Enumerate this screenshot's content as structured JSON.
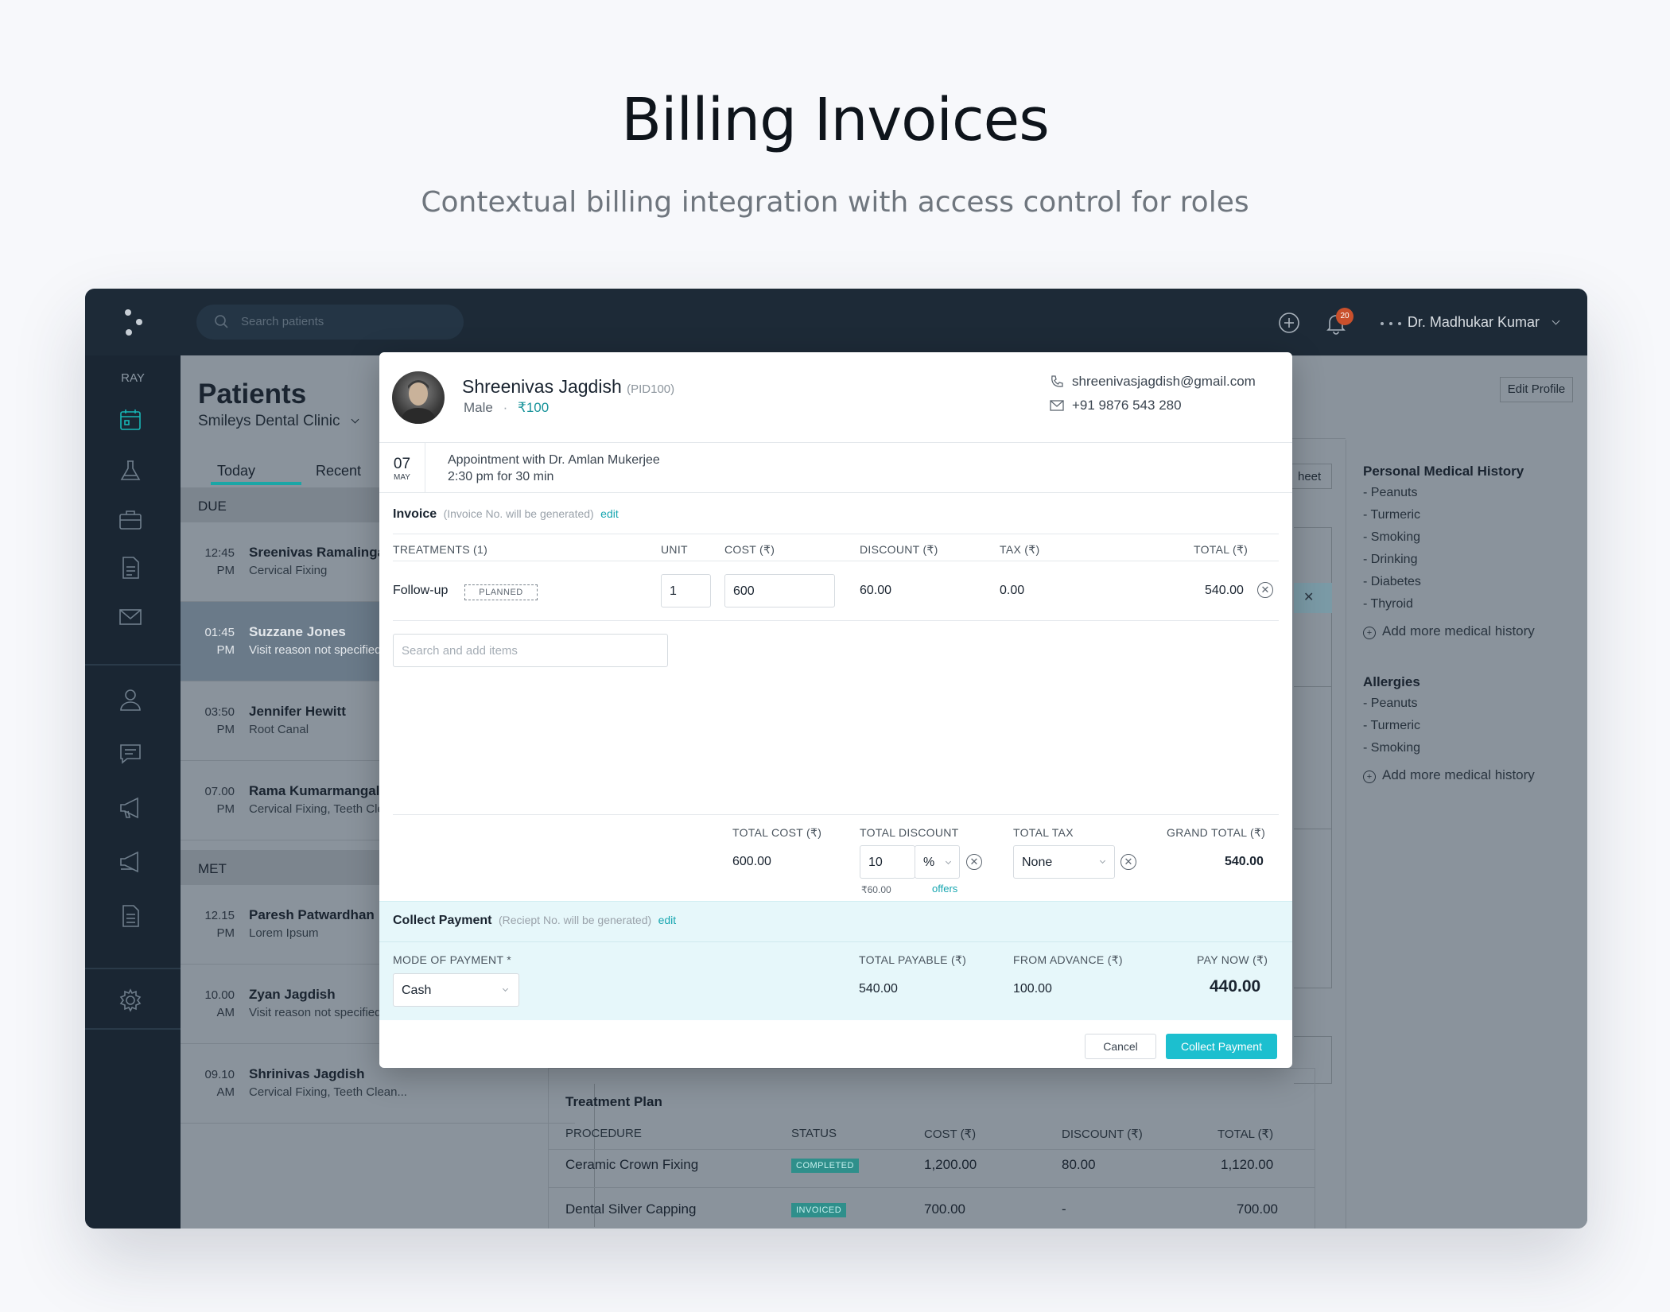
{
  "hero": {
    "title": "Billing Invoices",
    "subtitle": "Contextual billing integration with access control for roles"
  },
  "colors": {
    "accent": "#1cbfcf",
    "sidebar": "#1a2633",
    "badge": "#c9502c"
  },
  "topbar": {
    "search_placeholder": "Search patients",
    "notification_count": "20",
    "user_name": "Dr. Madhukar Kumar"
  },
  "sidebar": {
    "label": "RAY",
    "icons": [
      "calendar-icon",
      "flask-icon",
      "briefcase-icon",
      "document-icon",
      "mail-icon",
      "doctor-icon",
      "chat-icon",
      "megaphone-icon",
      "megaphone-alt-icon",
      "report-icon",
      "gear-icon"
    ]
  },
  "patients": {
    "title": "Patients",
    "clinic": "Smileys Dental Clinic",
    "tabs": [
      "Today",
      "Recent"
    ],
    "due_label": "DUE",
    "met_label": "MET",
    "due": [
      {
        "time": "12:45",
        "ampm": "PM",
        "name": "Sreenivas Ramalingam",
        "reason": "Cervical Fixing"
      },
      {
        "time": "01:45",
        "ampm": "PM",
        "name": "Suzzane Jones",
        "reason": "Visit reason not specified"
      },
      {
        "time": "03:50",
        "ampm": "PM",
        "name": "Jennifer Hewitt",
        "reason": "Root Canal"
      },
      {
        "time": "07.00",
        "ampm": "PM",
        "name": "Rama Kumarmangalam",
        "reason": "Cervical Fixing, Teeth Cleaning"
      }
    ],
    "met": [
      {
        "time": "12.15",
        "ampm": "PM",
        "name": "Paresh Patwardhan",
        "reason": "Lorem Ipsum"
      },
      {
        "time": "10.00",
        "ampm": "AM",
        "name": "Zyan Jagdish",
        "reason": "Visit reason not specified"
      },
      {
        "time": "09.10",
        "ampm": "AM",
        "name": "Shrinivas Jagdish",
        "reason": "Cervical Fixing, Teeth Clean..."
      }
    ]
  },
  "profile": {
    "edit_label": "Edit Profile",
    "sheet_label": "heet",
    "medical_history_title": "Personal Medical History",
    "medical_history": [
      "- Peanuts",
      "- Turmeric",
      "- Smoking",
      "- Drinking",
      "- Diabetes",
      "- Thyroid"
    ],
    "add_history": "Add more medical history",
    "allergies_title": "Allergies",
    "allergies": [
      "- Peanuts",
      "- Turmeric",
      "- Smoking"
    ],
    "add_allergies": "Add more medical history"
  },
  "treatment_plan": {
    "title": "Treatment Plan",
    "headers": [
      "PROCEDURE",
      "STATUS",
      "COST (₹)",
      "DISCOUNT (₹)",
      "TOTAL (₹)"
    ],
    "rows": [
      {
        "procedure": "Ceramic Crown Fixing",
        "status": "COMPLETED",
        "cost": "1,200.00",
        "discount": "80.00",
        "total": "1,120.00"
      },
      {
        "procedure": "Dental Silver Capping",
        "status": "INVOICED",
        "cost": "700.00",
        "discount": "-",
        "total": "700.00"
      }
    ]
  },
  "modal": {
    "patient_name": "Shreenivas Jagdish",
    "pid": "(PID100)",
    "gender": "Male",
    "fee": "₹100",
    "email": "shreenivasjagdish@gmail.com",
    "phone": "+91 9876 543 280",
    "appt_day": "07",
    "appt_month": "MAY",
    "appt_line1": "Appointment with Dr. Amlan Mukerjee",
    "appt_line2": "2:30 pm for 30 min",
    "invoice_title": "Invoice",
    "invoice_note": "(Invoice No. will be generated)",
    "edit": "edit",
    "headers": {
      "treatments": "TREATMENTS (1)",
      "unit": "UNIT",
      "cost": "COST (₹)",
      "discount": "DISCOUNT (₹)",
      "tax": "TAX (₹)",
      "total": "TOTAL (₹)"
    },
    "item": {
      "name": "Follow-up",
      "status": "PLANNED",
      "unit": "1",
      "cost": "600",
      "discount": "60.00",
      "tax": "0.00",
      "total": "540.00"
    },
    "search_placeholder": "Search and add items",
    "totals": {
      "cost_label": "TOTAL COST (₹)",
      "cost": "600.00",
      "discount_label": "TOTAL DISCOUNT",
      "discount_value": "10",
      "discount_unit": "%",
      "discount_amount": "₹60.00",
      "offers": "offers",
      "tax_label": "TOTAL TAX",
      "tax_value": "None",
      "grand_label": "GRAND  TOTAL (₹)",
      "grand": "540.00"
    },
    "payment": {
      "title": "Collect Payment",
      "note": "(Reciept No. will be generated)",
      "edit": "edit",
      "mode_label": "MODE OF PAYMENT *",
      "mode": "Cash",
      "payable_label": "TOTAL PAYABLE (₹)",
      "payable": "540.00",
      "advance_label": "FROM ADVANCE (₹)",
      "advance": "100.00",
      "paynow_label": "PAY NOW (₹)",
      "paynow": "440.00"
    },
    "cancel": "Cancel",
    "collect": "Collect Payment"
  }
}
